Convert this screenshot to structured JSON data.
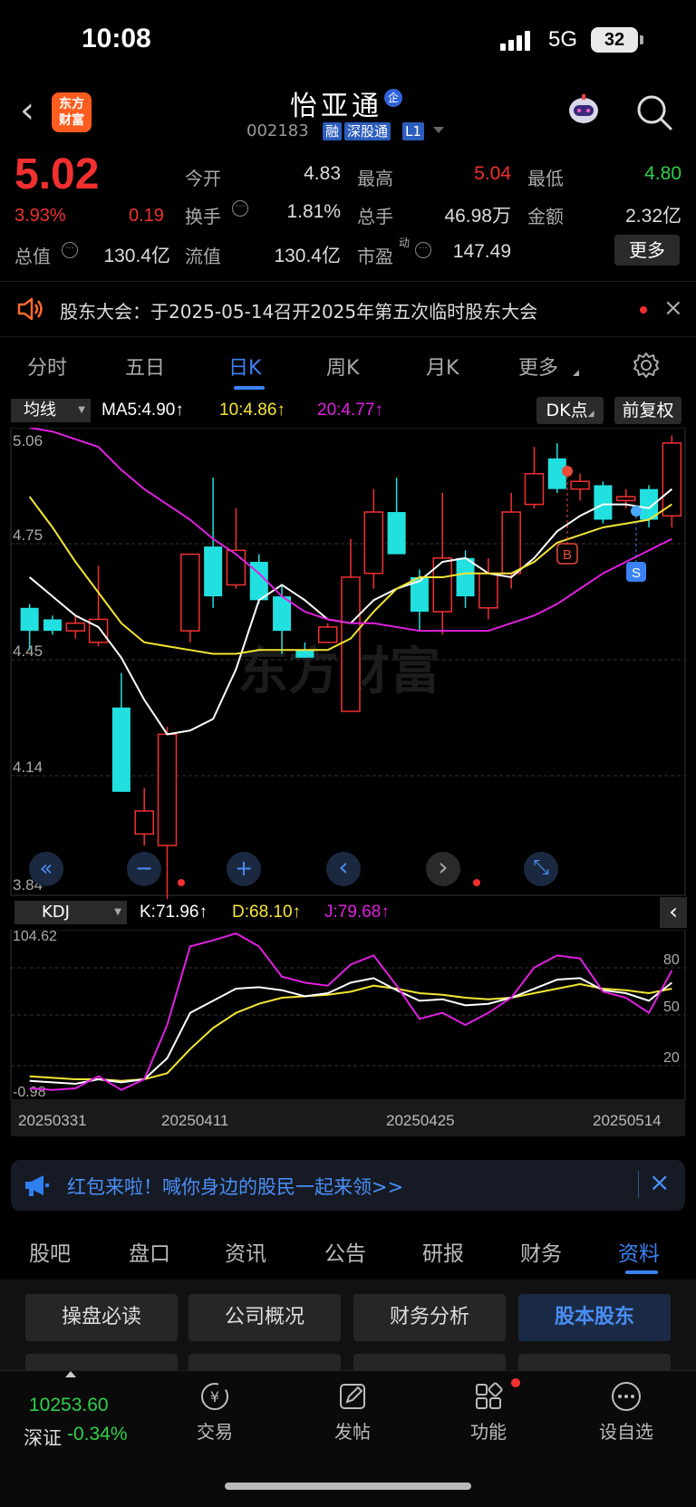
{
  "status": {
    "time": "10:08",
    "network": "5G",
    "battery": "32"
  },
  "header": {
    "logo": [
      "东方",
      "财富"
    ],
    "title": "怡亚通",
    "qi_badge": "企",
    "code": "002183",
    "tags": [
      "融",
      "深股通",
      "L1"
    ]
  },
  "quote": {
    "price": "5.02",
    "pct": "3.93%",
    "change": "0.19",
    "labels": {
      "open": "今开",
      "high": "最高",
      "low": "最低",
      "turnover": "换手",
      "volume": "总手",
      "amount": "金额",
      "total_mv": "总值",
      "float_mv": "流值",
      "pe": "市盈",
      "pe_sup": "动"
    },
    "values": {
      "open": "4.83",
      "high": "5.04",
      "low": "4.80",
      "turnover": "1.81%",
      "volume": "46.98万",
      "amount": "2.32亿",
      "total_mv": "130.4亿",
      "float_mv": "130.4亿",
      "pe": "147.49"
    },
    "more": "更多"
  },
  "notice": {
    "text": "股东大会：于2025-05-14召开2025年第五次临时股东大会"
  },
  "tabs": [
    "分时",
    "五日",
    "日K",
    "周K",
    "月K",
    "更多"
  ],
  "ma_bar": {
    "select": "均线",
    "ma5": "MA5:4.90↑",
    "ma10": "10:4.86↑",
    "ma20": "20:4.77↑",
    "dk": "DK点",
    "fq": "前复权"
  },
  "chart_labels": {
    "y": [
      "5.06",
      "4.75",
      "4.45",
      "4.14",
      "3.84"
    ],
    "watermark": "东方财富",
    "b": "B",
    "s": "S"
  },
  "kdj_bar": {
    "select": "KDJ",
    "k": "K:71.96↑",
    "d": "D:68.10↑",
    "j": "J:79.68↑"
  },
  "kdj_labels": {
    "top": "104.62",
    "bottom": "-0.98",
    "levels": [
      "80",
      "50",
      "20"
    ],
    "dates": [
      "20250331",
      "20250411",
      "20250425",
      "20250514"
    ]
  },
  "colors": {
    "up": "#f23030",
    "down": "#22e0e0",
    "ma5": "#ffffff",
    "ma10": "#f5e633",
    "ma20": "#e020e0",
    "accent": "#3b82f6"
  },
  "chart_data": {
    "type": "candlestick",
    "ylim": [
      3.84,
      5.06
    ],
    "candles": [
      {
        "o": 4.59,
        "c": 4.53,
        "h": 4.6,
        "l": 4.48
      },
      {
        "o": 4.56,
        "c": 4.53,
        "h": 4.57,
        "l": 4.52
      },
      {
        "o": 4.53,
        "c": 4.55,
        "h": 4.57,
        "l": 4.51
      },
      {
        "o": 4.5,
        "c": 4.56,
        "h": 4.7,
        "l": 4.49
      },
      {
        "o": 4.33,
        "c": 4.11,
        "h": 4.42,
        "l": 4.11
      },
      {
        "o": 4.0,
        "c": 4.06,
        "h": 4.12,
        "l": 3.97
      },
      {
        "o": 3.97,
        "c": 4.26,
        "h": 4.28,
        "l": 3.82
      },
      {
        "o": 4.53,
        "c": 4.73,
        "h": 4.73,
        "l": 4.5
      },
      {
        "o": 4.75,
        "c": 4.62,
        "h": 4.93,
        "l": 4.59
      },
      {
        "o": 4.65,
        "c": 4.74,
        "h": 4.85,
        "l": 4.64
      },
      {
        "o": 4.71,
        "c": 4.61,
        "h": 4.73,
        "l": 4.6
      },
      {
        "o": 4.62,
        "c": 4.53,
        "h": 4.65,
        "l": 4.47
      },
      {
        "o": 4.48,
        "c": 4.46,
        "h": 4.5,
        "l": 4.46
      },
      {
        "o": 4.5,
        "c": 4.54,
        "h": 4.55,
        "l": 4.5
      },
      {
        "o": 4.32,
        "c": 4.67,
        "h": 4.77,
        "l": 4.32
      },
      {
        "o": 4.68,
        "c": 4.84,
        "h": 4.9,
        "l": 4.64
      },
      {
        "o": 4.84,
        "c": 4.73,
        "h": 4.93,
        "l": 4.73
      },
      {
        "o": 4.67,
        "c": 4.58,
        "h": 4.69,
        "l": 4.53
      },
      {
        "o": 4.58,
        "c": 4.72,
        "h": 4.89,
        "l": 4.52
      },
      {
        "o": 4.72,
        "c": 4.62,
        "h": 4.74,
        "l": 4.59
      },
      {
        "o": 4.59,
        "c": 4.68,
        "h": 4.72,
        "l": 4.56
      },
      {
        "o": 4.68,
        "c": 4.84,
        "h": 4.89,
        "l": 4.64
      },
      {
        "o": 4.86,
        "c": 4.94,
        "h": 5.01,
        "l": 4.85
      },
      {
        "o": 4.98,
        "c": 4.9,
        "h": 5.02,
        "l": 4.89
      },
      {
        "o": 4.9,
        "c": 4.92,
        "h": 4.94,
        "l": 4.87
      },
      {
        "o": 4.91,
        "c": 4.82,
        "h": 4.92,
        "l": 4.81
      },
      {
        "o": 4.87,
        "c": 4.88,
        "h": 4.9,
        "l": 4.85
      },
      {
        "o": 4.9,
        "c": 4.82,
        "h": 4.91,
        "l": 4.8
      },
      {
        "o": 4.83,
        "c": 5.02,
        "h": 5.04,
        "l": 4.8
      }
    ],
    "ma5": [
      4.67,
      4.62,
      4.57,
      4.54,
      4.46,
      4.35,
      4.26,
      4.27,
      4.3,
      4.43,
      4.61,
      4.65,
      4.61,
      4.56,
      4.55,
      4.61,
      4.64,
      4.66,
      4.71,
      4.72,
      4.68,
      4.67,
      4.72,
      4.79,
      4.83,
      4.86,
      4.86,
      4.85,
      4.9
    ],
    "ma10": [
      4.88,
      4.8,
      4.71,
      4.63,
      4.55,
      4.5,
      4.49,
      4.48,
      4.47,
      4.47,
      4.48,
      4.48,
      4.48,
      4.48,
      4.51,
      4.58,
      4.64,
      4.67,
      4.67,
      4.68,
      4.68,
      4.68,
      4.71,
      4.76,
      4.78,
      4.8,
      4.81,
      4.82,
      4.86
    ],
    "ma20": [
      5.06,
      5.05,
      5.03,
      5.01,
      4.95,
      4.9,
      4.86,
      4.82,
      4.77,
      4.73,
      4.68,
      4.62,
      4.58,
      4.56,
      4.55,
      4.55,
      4.54,
      4.53,
      4.53,
      4.53,
      4.53,
      4.55,
      4.57,
      4.6,
      4.64,
      4.68,
      4.71,
      4.74,
      4.77
    ],
    "kdj": {
      "ylim": [
        -0.98,
        104.62
      ],
      "k": [
        7,
        6,
        5,
        8,
        6,
        8,
        22,
        52,
        60,
        68,
        69,
        67,
        63,
        65,
        72,
        75,
        67,
        60,
        61,
        57,
        58,
        62,
        68,
        74,
        75,
        67,
        65,
        60,
        72
      ],
      "d": [
        10,
        9,
        8,
        8,
        7,
        8,
        12,
        28,
        42,
        52,
        58,
        62,
        63,
        64,
        66,
        70,
        68,
        65,
        64,
        62,
        61,
        62,
        65,
        68,
        71,
        68,
        67,
        65,
        68
      ],
      "j": [
        2,
        1,
        2,
        10,
        1,
        8,
        44,
        96,
        100,
        104.62,
        96,
        76,
        72,
        70,
        84,
        90,
        70,
        48,
        52,
        44,
        52,
        62,
        82,
        90,
        88,
        66,
        62,
        52,
        80
      ]
    }
  },
  "control_buttons": [
    "«",
    "−",
    "+",
    "‹",
    "›",
    "⤡"
  ],
  "red_packet": {
    "text": "红包来啦！喊你身边的股民一起来领>>"
  },
  "bottom_tabs": [
    "股吧",
    "盘口",
    "资讯",
    "公告",
    "研报",
    "财务",
    "资料"
  ],
  "info_buttons": [
    "操盘必读",
    "公司概况",
    "财务分析",
    "股本股东"
  ],
  "nav": {
    "index_value": "10253.60",
    "index_name": "深证",
    "index_change": "-0.34%",
    "items": [
      "交易",
      "发帖",
      "功能",
      "设自选"
    ]
  }
}
